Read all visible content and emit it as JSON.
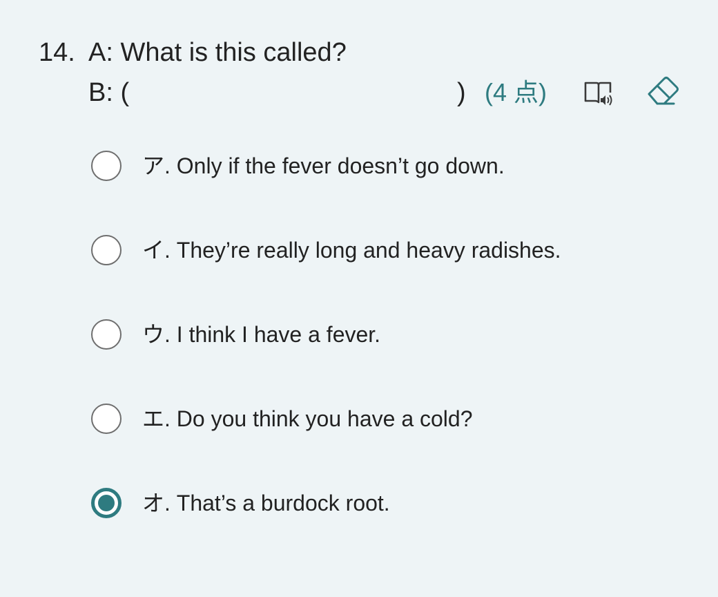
{
  "question": {
    "number": "14.",
    "line_a": "A: What is this called?",
    "line_b_open": "B: (",
    "line_b_close": ")",
    "points": "(4 点)",
    "accent_color": "#2e7b80"
  },
  "toolbar": {
    "read_aloud_icon": "book-speaker-icon",
    "eraser_icon": "eraser-icon"
  },
  "options": [
    {
      "label": "ア. Only if the fever doesn’t go down.",
      "selected": false
    },
    {
      "label": "イ. They’re really long and heavy radishes.",
      "selected": false
    },
    {
      "label": "ウ. I think I have a fever.",
      "selected": false
    },
    {
      "label": "エ. Do you think you have a cold?",
      "selected": false
    },
    {
      "label": "オ. That’s a burdock root.",
      "selected": true
    }
  ]
}
